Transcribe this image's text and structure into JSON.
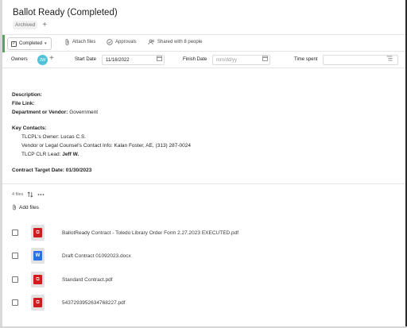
{
  "header": {
    "title": "Ballot Ready (Completed)",
    "archived_label": "Archived",
    "add_symbol": "+"
  },
  "toolbar": {
    "completed_label": "Completed",
    "completed_check": "✓",
    "completed_caret": "▾",
    "attach_label": "Attach files",
    "approvals_label": "Approvals",
    "shared_label": "Shared with 8 people"
  },
  "fields": {
    "owners_label": "Owners",
    "owner_initials": "JW",
    "add_owner_symbol": "+",
    "start_label": "Start Date",
    "start_value": "11/16/2022",
    "finish_label": "Finish Date",
    "finish_placeholder": "mm/dd/yy",
    "time_label": "Time spent"
  },
  "description": {
    "description_label": "Description:",
    "file_link_label": "File Link:",
    "dept_label": "Department or Vendor:",
    "dept_value": "Government",
    "contacts_label": "Key Contacts:",
    "owner_line_label": "TLCPL's Owner:",
    "owner_line_value": "Lucas C.S.",
    "vendor_line_label": "Vendor or Legal Counsel's Contact Info:",
    "vendor_line_value": "Kalan Foster, AE, (313) 287-0024",
    "clr_line_label": "TLCP CLR Lead:",
    "clr_line_value": "Jeff W.",
    "target_label": "Contract Target Date:",
    "target_value": "01/30/2023"
  },
  "files": {
    "count_label": "4 files",
    "add_files_label": "Add files",
    "items": [
      {
        "name": "BallotReady Contract - Toledo Library Order Form 2.27.2023 EXECUTED.pdf",
        "type": "pdf"
      },
      {
        "name": "Draft Contract 01092023.docx",
        "type": "doc"
      },
      {
        "name": "Standard Contract.pdf",
        "type": "pdf"
      },
      {
        "name": "5437293952634768227.pdf",
        "type": "pdf"
      }
    ]
  },
  "colors": {
    "completed_accent": "#58a55c",
    "avatar": "#4fc3d9",
    "pdf_red": "#cf1c1c",
    "word_blue": "#2b6fe0"
  }
}
